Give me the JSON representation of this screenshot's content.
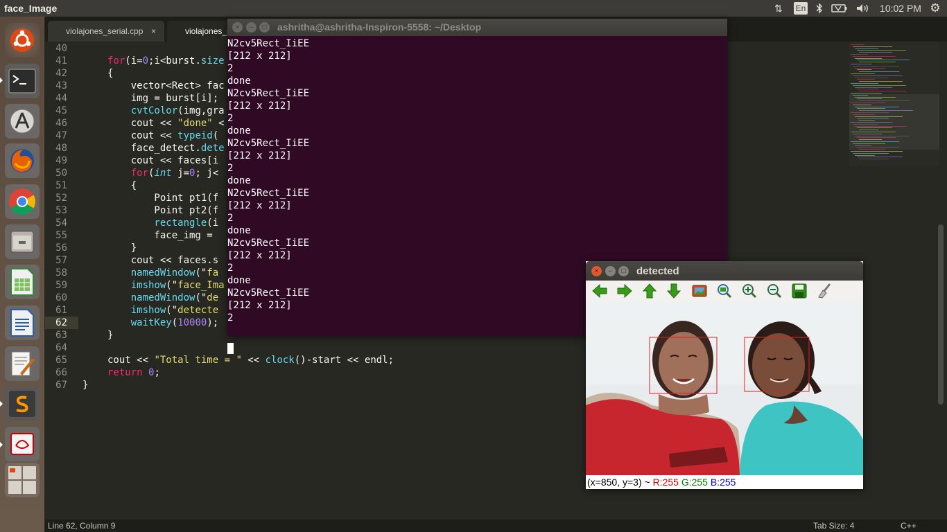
{
  "top_panel": {
    "app_title": "face_Image",
    "keyboard_layout": "En",
    "clock": "10:02 PM"
  },
  "launcher": {
    "items": [
      "ubuntu-dash",
      "terminal",
      "software-updater",
      "firefox",
      "chrome",
      "files",
      "libreoffice-calc",
      "libreoffice-writer",
      "text-editor",
      "sublime-text",
      "evince",
      "workspaces"
    ]
  },
  "editor": {
    "tabs": [
      {
        "label": "violajones_serial.cpp",
        "close": "×"
      },
      {
        "label": "violajones_s"
      }
    ],
    "line_numbers": [
      "40",
      "41",
      "42",
      "43",
      "44",
      "45",
      "46",
      "47",
      "48",
      "49",
      "50",
      "51",
      "52",
      "53",
      "54",
      "55",
      "56",
      "57",
      "58",
      "59",
      "60",
      "61",
      "62",
      "63",
      "64",
      "65",
      "66",
      "67"
    ],
    "lines": [
      [],
      [
        {
          "c": "k",
          "t": "for"
        },
        {
          "c": "",
          "t": "(i="
        },
        {
          "c": "n",
          "t": "0"
        },
        {
          "c": "",
          "t": ";i<burst."
        },
        {
          "c": "f",
          "t": "size"
        }
      ],
      [
        {
          "c": "",
          "t": "{"
        }
      ],
      [
        {
          "c": "",
          "t": "    vector<Rect> fac"
        }
      ],
      [
        {
          "c": "",
          "t": "    img = burst[i];"
        }
      ],
      [
        {
          "c": "f",
          "t": "    cvtColor"
        },
        {
          "c": "",
          "t": "(img,gra"
        }
      ],
      [
        {
          "c": "",
          "t": "    cout << "
        },
        {
          "c": "s",
          "t": "\"done\""
        },
        {
          "c": "",
          "t": " <"
        }
      ],
      [
        {
          "c": "",
          "t": "    cout << "
        },
        {
          "c": "f",
          "t": "typeid"
        },
        {
          "c": "",
          "t": "("
        }
      ],
      [
        {
          "c": "",
          "t": "    face_detect."
        },
        {
          "c": "f",
          "t": "dete"
        }
      ],
      [
        {
          "c": "",
          "t": "    cout << faces[i"
        }
      ],
      [
        {
          "c": "k",
          "t": "    for"
        },
        {
          "c": "",
          "t": "("
        },
        {
          "c": "t",
          "t": "int"
        },
        {
          "c": "",
          "t": " j="
        },
        {
          "c": "n",
          "t": "0"
        },
        {
          "c": "",
          "t": "; j<"
        }
      ],
      [
        {
          "c": "",
          "t": "    {"
        }
      ],
      [
        {
          "c": "",
          "t": "        Point pt1(f"
        }
      ],
      [
        {
          "c": "",
          "t": "        Point pt2(f"
        }
      ],
      [
        {
          "c": "f",
          "t": "        rectangle"
        },
        {
          "c": "",
          "t": "(i"
        }
      ],
      [
        {
          "c": "",
          "t": "        face_img = "
        }
      ],
      [
        {
          "c": "",
          "t": "    }"
        }
      ],
      [
        {
          "c": "",
          "t": "    cout << faces.s"
        }
      ],
      [
        {
          "c": "f",
          "t": "    namedWindow"
        },
        {
          "c": "",
          "t": "(\""
        },
        {
          "c": "s",
          "t": "fa"
        }
      ],
      [
        {
          "c": "f",
          "t": "    imshow"
        },
        {
          "c": "",
          "t": "(\""
        },
        {
          "c": "s",
          "t": "face_Ima"
        }
      ],
      [
        {
          "c": "f",
          "t": "    namedWindow"
        },
        {
          "c": "",
          "t": "(\""
        },
        {
          "c": "s",
          "t": "de"
        }
      ],
      [
        {
          "c": "f",
          "t": "    imshow"
        },
        {
          "c": "",
          "t": "(\""
        },
        {
          "c": "s",
          "t": "detecte"
        }
      ],
      [
        {
          "c": "f",
          "t": "    waitKey"
        },
        {
          "c": "",
          "t": "("
        },
        {
          "c": "n",
          "t": "10000"
        },
        {
          "c": "",
          "t": ");"
        }
      ],
      [
        {
          "c": "",
          "t": "}"
        }
      ],
      [],
      [
        {
          "c": "",
          "t": "cout << "
        },
        {
          "c": "s",
          "t": "\"Total time = \""
        },
        {
          "c": "",
          "t": " << "
        },
        {
          "c": "f",
          "t": "clock"
        },
        {
          "c": "",
          "t": "()-start << endl;"
        }
      ],
      [
        {
          "c": "k",
          "t": "return"
        },
        {
          "c": "",
          "t": " "
        },
        {
          "c": "n",
          "t": "0"
        },
        {
          "c": "",
          "t": ";"
        }
      ],
      [
        {
          "c": "",
          "t": "}"
        }
      ]
    ],
    "status": {
      "position": "Line 62, Column 9",
      "tab_size": "Tab Size: 4",
      "syntax": "C++"
    }
  },
  "terminal": {
    "title": "ashritha@ashritha-Inspiron-5558: ~/Desktop",
    "lines": [
      "N2cv5Rect_IiEE",
      "[212 x 212]",
      "2",
      "done",
      "N2cv5Rect_IiEE",
      "[212 x 212]",
      "2",
      "done",
      "N2cv5Rect_IiEE",
      "[212 x 212]",
      "2",
      "done",
      "N2cv5Rect_IiEE",
      "[212 x 212]",
      "2",
      "done",
      "N2cv5Rect_IiEE",
      "[212 x 212]",
      "2",
      "done",
      "N2cv5Rect_IiEE",
      "[212 x 212]",
      "2"
    ]
  },
  "detected_window": {
    "title": "detected",
    "tools": [
      "pan-left-icon",
      "pan-right-icon",
      "pan-up-icon",
      "pan-down-icon",
      "zoom-original-icon",
      "zoom-fit-icon",
      "zoom-in-icon",
      "zoom-out-icon",
      "save-icon",
      "properties-icon"
    ],
    "status": {
      "coords": "(x=850, y=3) ~ ",
      "r": "R:255",
      "g": "G:255",
      "b": "B:255"
    }
  },
  "colors": {
    "terminal_bg": "#300a24",
    "editor_bg": "#272822",
    "detection_box": "#e02020",
    "r_color": "#e00000",
    "g_color": "#008000",
    "b_color": "#0000e0"
  }
}
